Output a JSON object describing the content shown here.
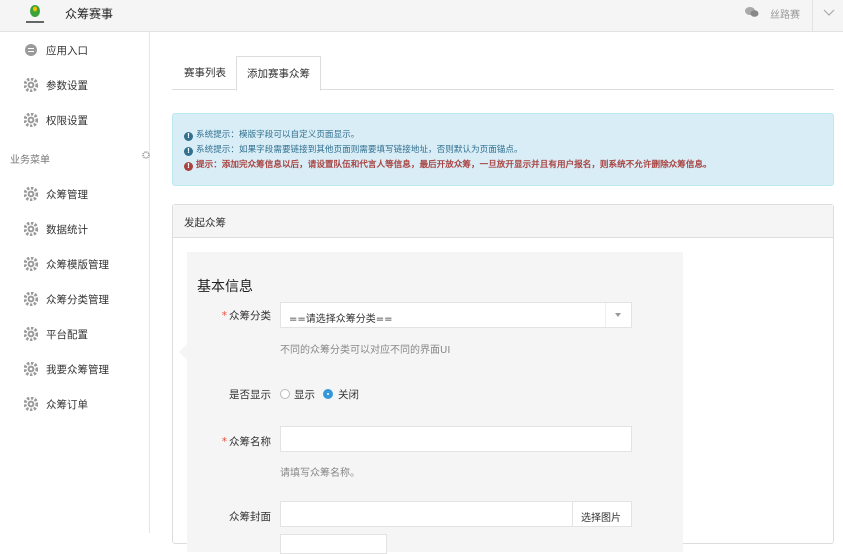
{
  "header": {
    "app_title": "众筹赛事",
    "user_name": "丝路赛",
    "icons": {
      "logo": "app-logo",
      "wechat": "wechat-icon",
      "dropdown": "chevron-down-icon"
    }
  },
  "sidebar": {
    "top_items": [
      {
        "label": "应用入口",
        "icon": "app-entry-icon"
      },
      {
        "label": "参数设置",
        "icon": "gear-icon"
      },
      {
        "label": "权限设置",
        "icon": "gear-icon"
      }
    ],
    "section_label": "业务菜单",
    "section_items": [
      {
        "label": "众筹管理",
        "icon": "gear-icon"
      },
      {
        "label": "数据统计",
        "icon": "gear-icon"
      },
      {
        "label": "众筹模版管理",
        "icon": "gear-icon"
      },
      {
        "label": "众筹分类管理",
        "icon": "gear-icon"
      },
      {
        "label": "平台配置",
        "icon": "gear-icon"
      },
      {
        "label": "我要众筹管理",
        "icon": "gear-icon"
      },
      {
        "label": "众筹订单",
        "icon": "gear-icon"
      }
    ]
  },
  "tabs": [
    {
      "label": "赛事列表",
      "active": false
    },
    {
      "label": "添加赛事众筹",
      "active": true
    }
  ],
  "alert": {
    "line1": "系统提示：模版字段可以自定义页面显示。",
    "line2": "系统提示：如果字段需要链接到其他页面则需要填写链接地址，否则默认为页面锚点。",
    "line3": "提示：添加完众筹信息以后，请设置队伍和代言人等信息，最后开放众筹，一旦放开显示并且有用户报名，则系统不允许删除众筹信息。"
  },
  "panel": {
    "title": "发起众筹",
    "section_title": "基本信息",
    "category": {
      "label": "众筹分类",
      "value": "==请选择众筹分类==",
      "hint": "不同的众筹分类可以对应不同的界面UI"
    },
    "display": {
      "label": "是否显示",
      "options": [
        "显示",
        "关闭"
      ],
      "selected": "关闭"
    },
    "name": {
      "label": "众筹名称",
      "value": "",
      "hint": "请填写众筹名称。"
    },
    "cover": {
      "label": "众筹封面",
      "value": "",
      "button": "选择图片"
    }
  },
  "colors": {
    "accent": "#3498db",
    "alert_info": "#31708f",
    "alert_warn": "#a94442",
    "required": "#e74c3c"
  }
}
